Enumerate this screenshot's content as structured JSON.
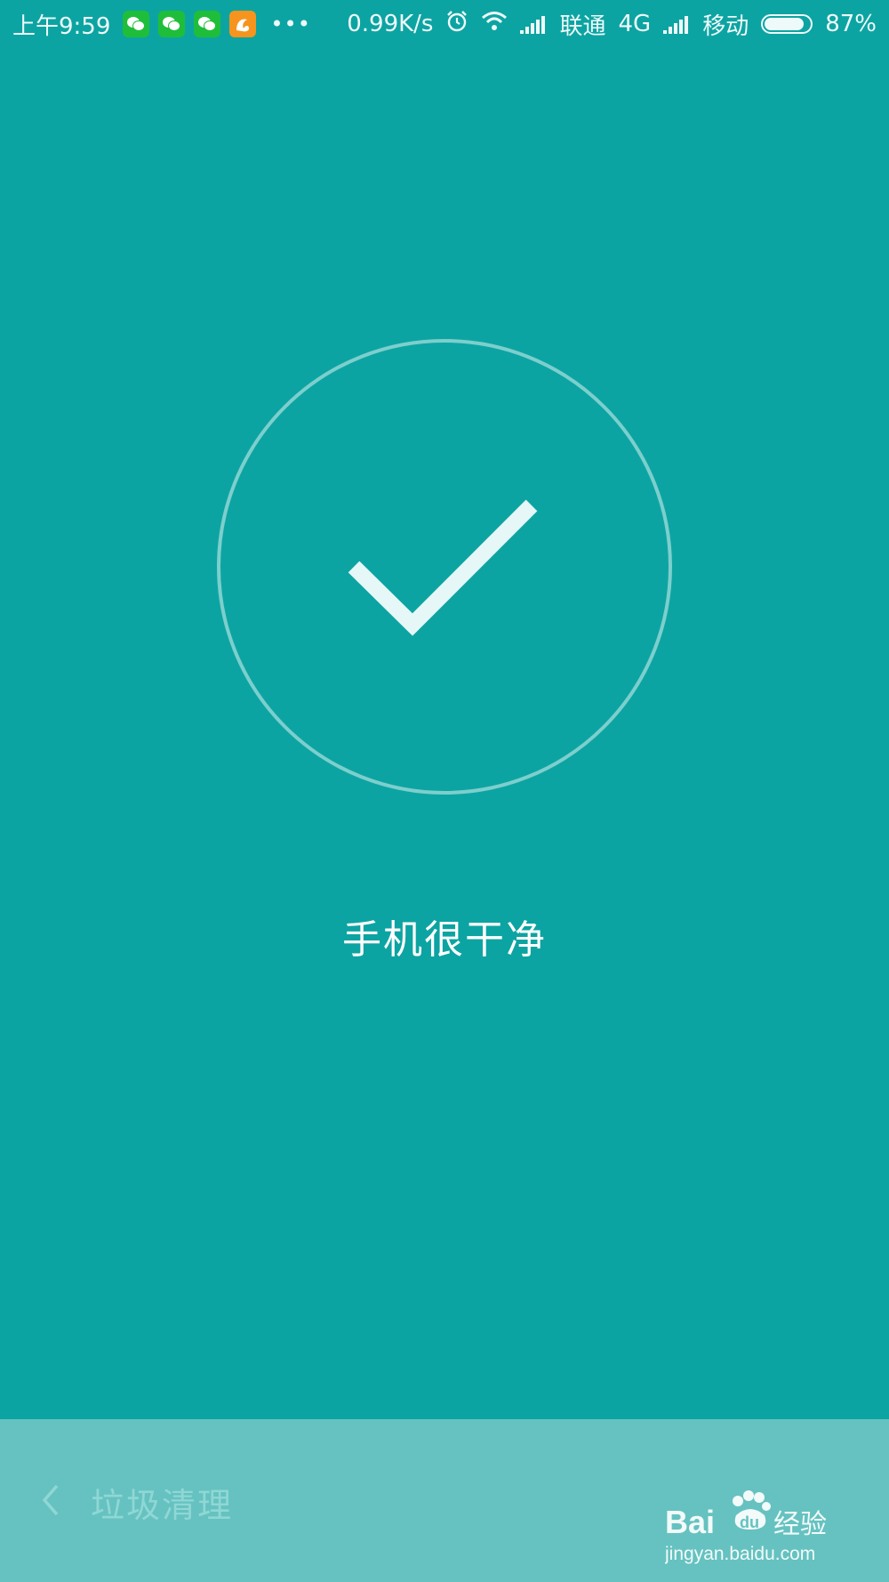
{
  "status_bar": {
    "time": "上午9:59",
    "more": "•••",
    "net_speed": "0.99K/s",
    "carrier1": "联通",
    "network_type": "4G",
    "carrier2": "移动",
    "battery": "87%",
    "battery_level": 0.87,
    "notification_icons": [
      "wechat-icon",
      "wechat-icon",
      "wechat-icon",
      "uc-browser-icon"
    ]
  },
  "main": {
    "status_text": "手机很干净"
  },
  "bottom_bar": {
    "back_icon": "chevron-left-icon",
    "title": "垃圾清理"
  },
  "watermark": {
    "logo": "Baidu经验",
    "url": "jingyan.baidu.com"
  },
  "colors": {
    "background": "#0ca4a2",
    "bottom_bar": "#65c2c0",
    "circle": "#7ccfcd",
    "check": "#e6f7f7"
  }
}
